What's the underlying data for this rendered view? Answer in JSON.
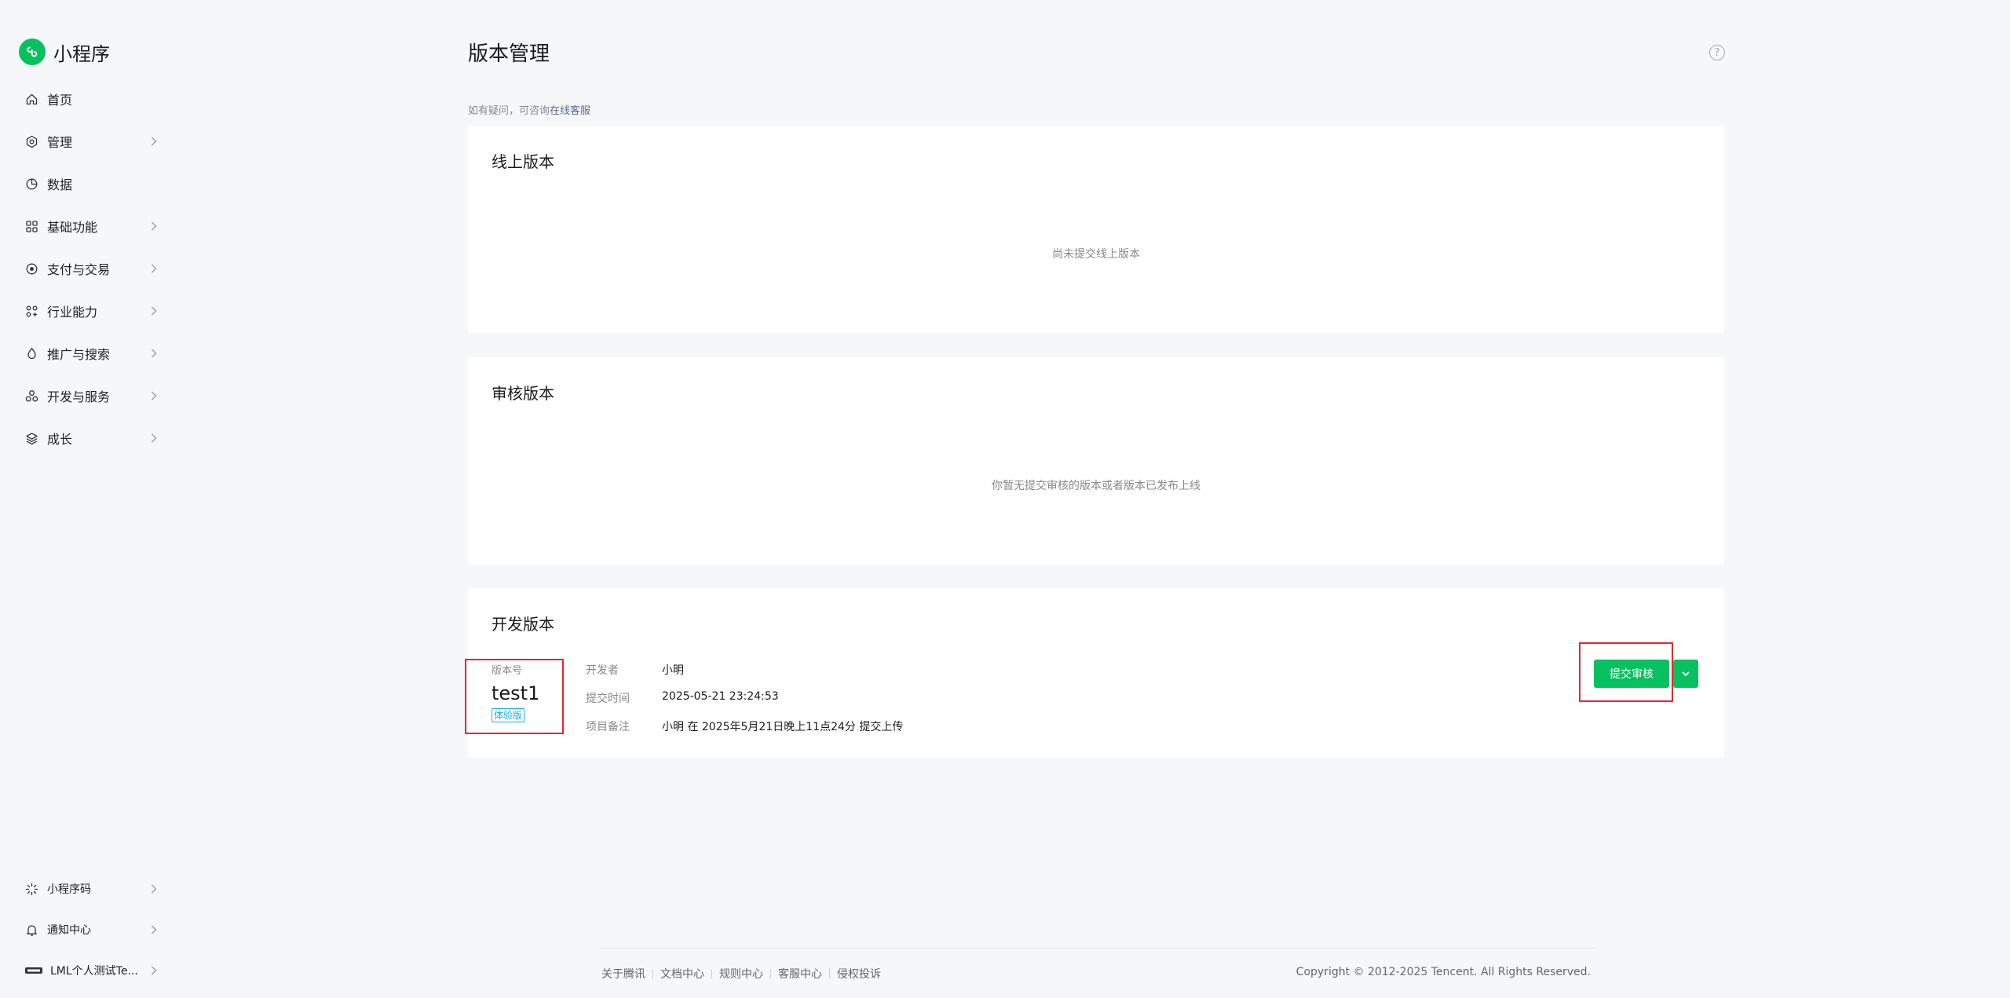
{
  "brand": {
    "name": "小程序",
    "color": "#07c160"
  },
  "sidebar": {
    "items": [
      {
        "label": "首页",
        "icon": "home-icon",
        "has_arrow": false
      },
      {
        "label": "管理",
        "icon": "settings-icon",
        "has_arrow": true
      },
      {
        "label": "数据",
        "icon": "pie-chart-icon",
        "has_arrow": false
      },
      {
        "label": "基础功能",
        "icon": "grid-icon",
        "has_arrow": true
      },
      {
        "label": "支付与交易",
        "icon": "pay-icon",
        "has_arrow": true
      },
      {
        "label": "行业能力",
        "icon": "industry-icon",
        "has_arrow": true
      },
      {
        "label": "推广与搜索",
        "icon": "promote-icon",
        "has_arrow": true
      },
      {
        "label": "开发与服务",
        "icon": "dev-icon",
        "has_arrow": true
      },
      {
        "label": "成长",
        "icon": "growth-icon",
        "has_arrow": true
      }
    ],
    "bottom": [
      {
        "label": "小程序码",
        "icon": "qrcode-icon"
      },
      {
        "label": "通知中心",
        "icon": "bell-icon"
      },
      {
        "label": "LML个人测试Te...",
        "icon": "account-avatar-icon"
      }
    ]
  },
  "page": {
    "title": "版本管理",
    "tip_prefix": "如有疑问，可咨询",
    "tip_link": "在线客服"
  },
  "online": {
    "title": "线上版本",
    "empty": "尚未提交线上版本"
  },
  "review": {
    "title": "审核版本",
    "empty": "你暂无提交审核的版本或者版本已发布上线"
  },
  "dev": {
    "title": "开发版本",
    "version_label": "版本号",
    "version": "test1",
    "badge": "体验版 ",
    "developer_label": "开发者",
    "developer": "小明",
    "time_label": "提交时间",
    "time": "2025-05-21 23:24:53",
    "note_label": "项目备注",
    "note": "小明 在 2025年5月21日晚上11点24分 提交上传",
    "submit_label": "提交审核"
  },
  "footer": {
    "links": [
      "关于腾讯",
      "文档中心",
      "规则中心",
      "客服中心",
      "侵权投诉"
    ],
    "copyright": "Copyright © 2012-2025 Tencent. All Rights Reserved."
  },
  "colors": {
    "accent": "#07c160",
    "link": "#576b95",
    "highlight": "#e8262f",
    "badge": "#10aeff"
  }
}
